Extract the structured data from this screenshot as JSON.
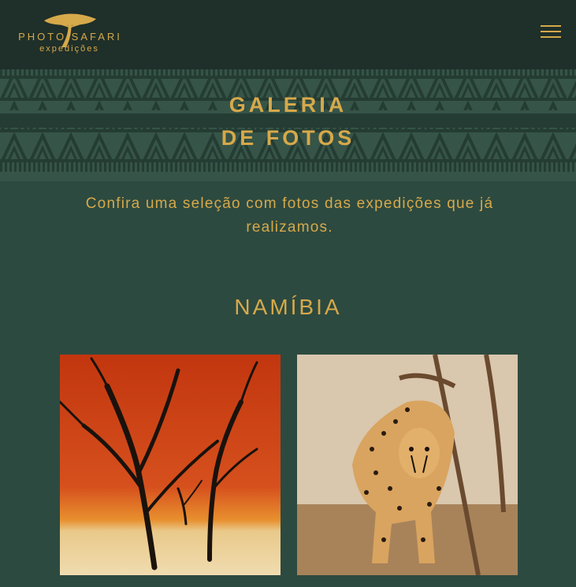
{
  "header": {
    "logo_title": "PHOTO SAFARI",
    "logo_subtitle": "expedições",
    "menu_icon": "hamburger-menu-icon"
  },
  "banner": {
    "title_line1": "GALERIA",
    "title_line2": "DE FOTOS"
  },
  "intro": {
    "text": "Confira uma seleção com fotos das expedições que já realizamos."
  },
  "section": {
    "title": "NAMÍBIA"
  },
  "gallery": [
    {
      "subject": "dead-trees-red-dune"
    },
    {
      "subject": "cheetah"
    }
  ],
  "colors": {
    "accent": "#d6a94a",
    "background": "#2d4a40",
    "header_bg": "#1f2f29"
  }
}
